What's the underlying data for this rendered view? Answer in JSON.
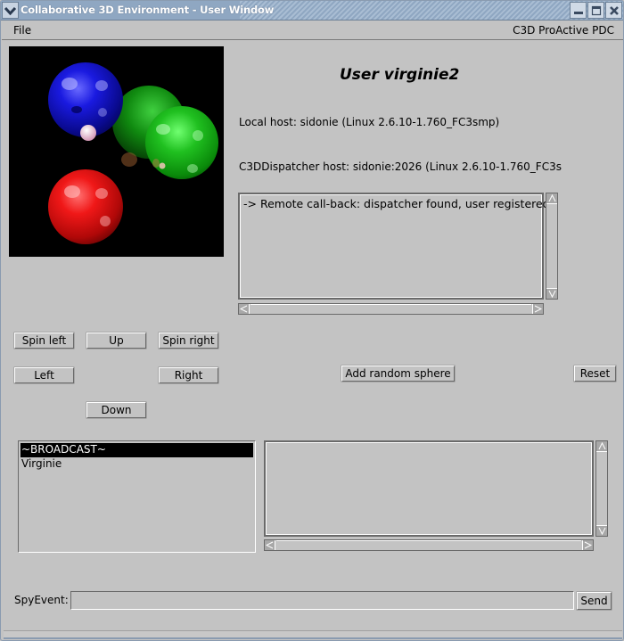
{
  "window": {
    "title": "Collaborative 3D Environment - User Window",
    "controls": {
      "menu_icon": "chevron-down-icon",
      "minimize_icon": "minimize-icon",
      "maximize_icon": "maximize-icon",
      "close_icon": "close-icon"
    }
  },
  "menubar": {
    "file_label": "File",
    "brand_label": "C3D ProActive PDC"
  },
  "scene": {
    "description": "3D rendered view of four reflective spheres on black background",
    "spheres": [
      {
        "color": "#1010d0",
        "name": "blue"
      },
      {
        "color": "#10a010",
        "name": "green-back"
      },
      {
        "color": "#10c010",
        "name": "green-front"
      },
      {
        "color": "#e01010",
        "name": "red"
      },
      {
        "color": "#f0c8d8",
        "name": "small-pink"
      }
    ]
  },
  "info": {
    "user_title": "User virginie2",
    "local_host": "Local host: sidonie (Linux 2.6.10-1.760_FC3smp)",
    "dispatcher_host": "C3DDispatcher host: sidonie:2026 (Linux 2.6.10-1.760_FC3s"
  },
  "log": {
    "lines": [
      "-> Remote call-back: dispatcher found, user registered"
    ]
  },
  "controls": {
    "spin_left": "Spin left",
    "up": "Up",
    "spin_right": "Spin right",
    "left": "Left",
    "right": "Right",
    "down": "Down",
    "add_random_sphere": "Add random sphere",
    "reset": "Reset"
  },
  "users": {
    "items": [
      {
        "label": "~BROADCAST~",
        "selected": true
      },
      {
        "label": "Virginie",
        "selected": false
      }
    ]
  },
  "chat": {
    "lines": []
  },
  "spy": {
    "label": "SpyEvent:",
    "value": "",
    "send_label": "Send"
  }
}
